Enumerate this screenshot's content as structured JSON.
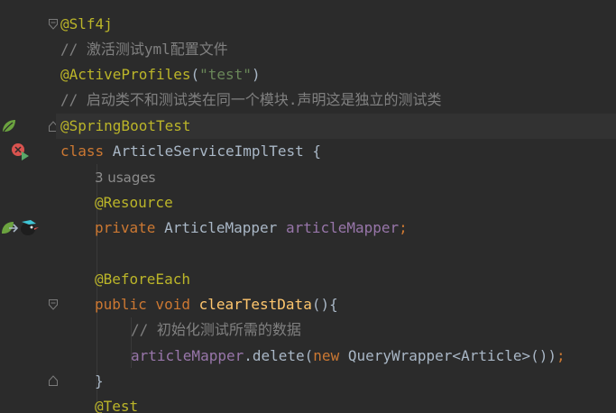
{
  "lines": {
    "l1": {
      "ann": "@Slf4j"
    },
    "l2": {
      "cmt": "// 激活测试yml配置文件"
    },
    "l3": {
      "ann": "@ActiveProfiles",
      "p1": "(",
      "str": "\"test\"",
      "p2": ")"
    },
    "l4": {
      "cmt": "// 启动类不和测试类在同一个模块.声明这是独立的测试类"
    },
    "l5": {
      "ann": "@SpringBootTest"
    },
    "l6": {
      "kw": "class",
      "name": " ArticleServiceImplTest {"
    },
    "l7": {
      "usages": "3 usages"
    },
    "l8": {
      "ann": "@Resource"
    },
    "l9": {
      "kw": "private",
      "type": " ArticleMapper ",
      "field": "articleMapper",
      "semi": ";"
    },
    "l11": {
      "ann": "@BeforeEach"
    },
    "l12": {
      "kw1": "public",
      "kw2": " void ",
      "fn": "clearTestData",
      "rest": "(){"
    },
    "l13": {
      "cmt": "// 初始化测试所需的数据"
    },
    "l14": {
      "field": "articleMapper",
      "dot": ".delete(",
      "kw": "new",
      "type": " QueryWrapper<",
      "gen": "Article",
      "end": ">())",
      "semi": ";"
    },
    "l15": {
      "brace": "}"
    },
    "l16": {
      "ann": "@Test"
    }
  },
  "colors": {
    "background": "#2b2b2b",
    "annotation": "#bbb529",
    "comment": "#808080",
    "string": "#6a8759",
    "keyword": "#cc7832",
    "identifier": "#a9b7c6",
    "field": "#9876aa",
    "method": "#ffc66d"
  },
  "icons": {
    "spring_bean": "spring-leaf-icon",
    "run_test": "run-test-icon",
    "navigate_bean": "bean-navigate-icon"
  }
}
